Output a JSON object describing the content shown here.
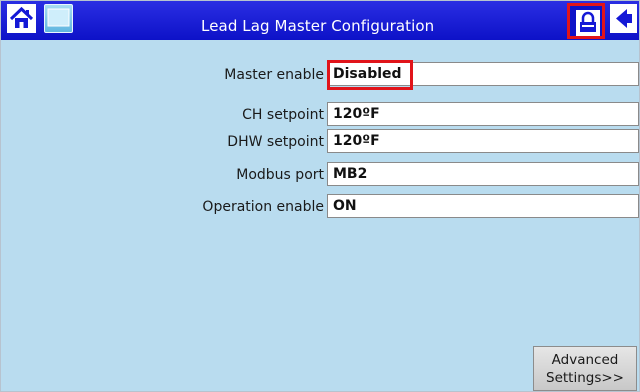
{
  "window": {
    "title": "Lead Lag Master Configuration"
  },
  "fields": [
    {
      "label": "Master enable",
      "value": "Disabled"
    },
    {
      "label": "CH setpoint",
      "value": "120ºF"
    },
    {
      "label": "DHW setpoint",
      "value": "120ºF"
    },
    {
      "label": "Modbus port",
      "value": "MB2"
    },
    {
      "label": "Operation enable",
      "value": "ON"
    }
  ],
  "footer": {
    "advanced_line1": "Advanced",
    "advanced_line2": "Settings>>"
  },
  "icons": {
    "home": "home-icon",
    "screen": "screen-icon",
    "lock": "lock-icon",
    "back": "back-arrow-icon"
  },
  "colors": {
    "titlebar": "#1418d6",
    "background": "#b9dcef",
    "highlight": "#e1141a"
  }
}
